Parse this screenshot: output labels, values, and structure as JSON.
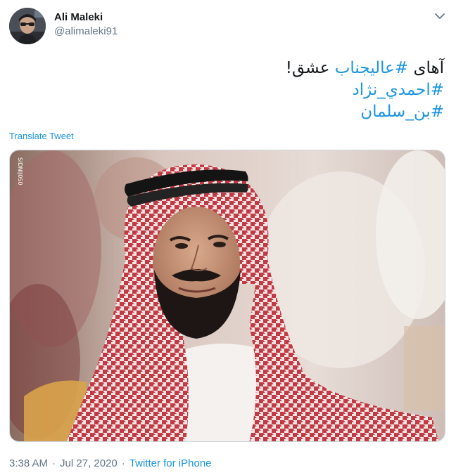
{
  "author": {
    "display_name": "Ali Maleki",
    "handle": "@alimaleki91",
    "avatar_icon": "user-avatar"
  },
  "menu": {
    "icon": "chevron-down-icon"
  },
  "tweet": {
    "line1_plain_before": "آهای ",
    "line1_hashtag": "#عالیجناب",
    "line1_plain_after": " عشق!",
    "hashtag2": "#احمدي_نژاد",
    "hashtag3": "#بن_سلمان",
    "translate_label": "Translate Tweet"
  },
  "media": {
    "watermark": "SIDNIJ0S0"
  },
  "meta": {
    "time": "3:38 AM",
    "separator": "·",
    "date": "Jul 27, 2020",
    "source": "Twitter for iPhone"
  },
  "colors": {
    "link": "#1b95e0",
    "secondary_text": "#657786",
    "primary_text": "#14171a",
    "keffiyeh_red": "#c23a44",
    "border": "#ccd6dd"
  }
}
